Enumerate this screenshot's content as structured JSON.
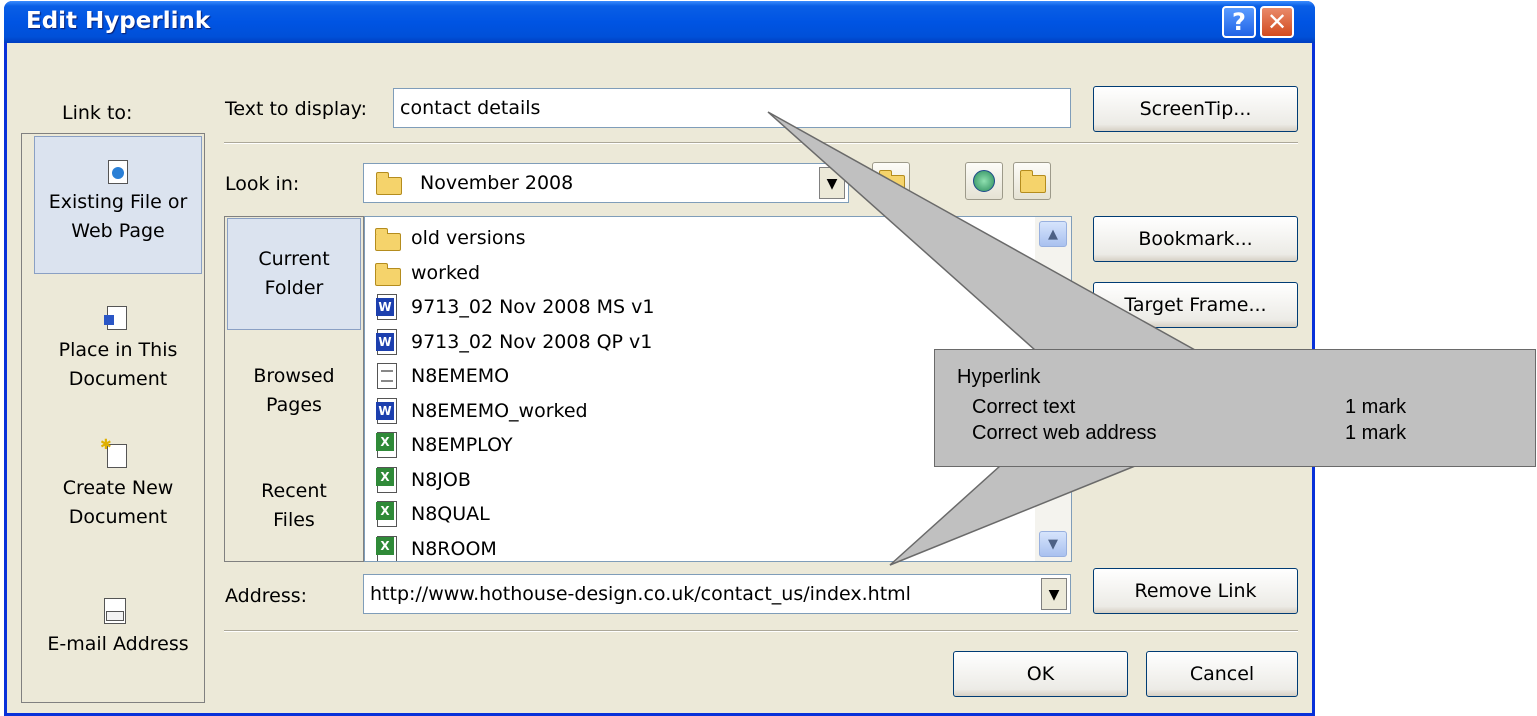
{
  "window": {
    "title": "Edit Hyperlink",
    "help_glyph": "?",
    "close_glyph": "✕"
  },
  "link_to": {
    "label": "Link to:",
    "items": [
      {
        "line1": "Existing File or",
        "line2": "Web Page",
        "icon": "web-page-icon",
        "selected": true
      },
      {
        "line1": "Place in This",
        "line2": "Document",
        "icon": "place-in-document-icon",
        "selected": false
      },
      {
        "line1": "Create New",
        "line2": "Document",
        "icon": "new-document-icon",
        "selected": false
      },
      {
        "line1": "E-mail Address",
        "line2": "",
        "icon": "email-icon",
        "selected": false
      }
    ]
  },
  "text_to_display": {
    "label": "Text to display:",
    "value": "contact details"
  },
  "screentip_label": "ScreenTip...",
  "look_in": {
    "label": "Look in:",
    "value": "November 2008",
    "arrow": "▼"
  },
  "places": [
    {
      "line1": "Current",
      "line2": "Folder",
      "selected": true
    },
    {
      "line1": "Browsed",
      "line2": "Pages",
      "selected": false
    },
    {
      "line1": "Recent",
      "line2": "Files",
      "selected": false
    }
  ],
  "files": [
    {
      "name": "old versions",
      "icon": "folder-icon"
    },
    {
      "name": "worked",
      "icon": "folder-icon"
    },
    {
      "name": "9713_02 Nov 2008 MS v1",
      "icon": "word-document-icon"
    },
    {
      "name": "9713_02 Nov 2008 QP v1",
      "icon": "word-document-icon"
    },
    {
      "name": "N8EMEMO",
      "icon": "text-document-icon"
    },
    {
      "name": "N8EMEMO_worked",
      "icon": "word-document-icon"
    },
    {
      "name": "N8EMPLOY",
      "icon": "excel-document-icon"
    },
    {
      "name": "N8JOB",
      "icon": "excel-document-icon"
    },
    {
      "name": "N8QUAL",
      "icon": "excel-document-icon"
    },
    {
      "name": "N8ROOM",
      "icon": "excel-document-icon"
    }
  ],
  "side_buttons": {
    "bookmark": "Bookmark...",
    "target_frame": "Target Frame..."
  },
  "address": {
    "label": "Address:",
    "value": "http://www.hothouse-design.co.uk/contact_us/index.html",
    "arrow": "▼"
  },
  "remove_link_label": "Remove Link",
  "ok_label": "OK",
  "cancel_label": "Cancel",
  "annotation": {
    "heading": "Hyperlink",
    "rows": [
      {
        "item": "Correct text",
        "marks": "1 mark"
      },
      {
        "item": "Correct web address",
        "marks": "1 mark"
      }
    ]
  },
  "colors": {
    "titlebar": "#0054e3",
    "dialog_bg": "#ece9d8",
    "annotation_bg": "#c0c0c0",
    "selection": "#dbe3ef"
  }
}
